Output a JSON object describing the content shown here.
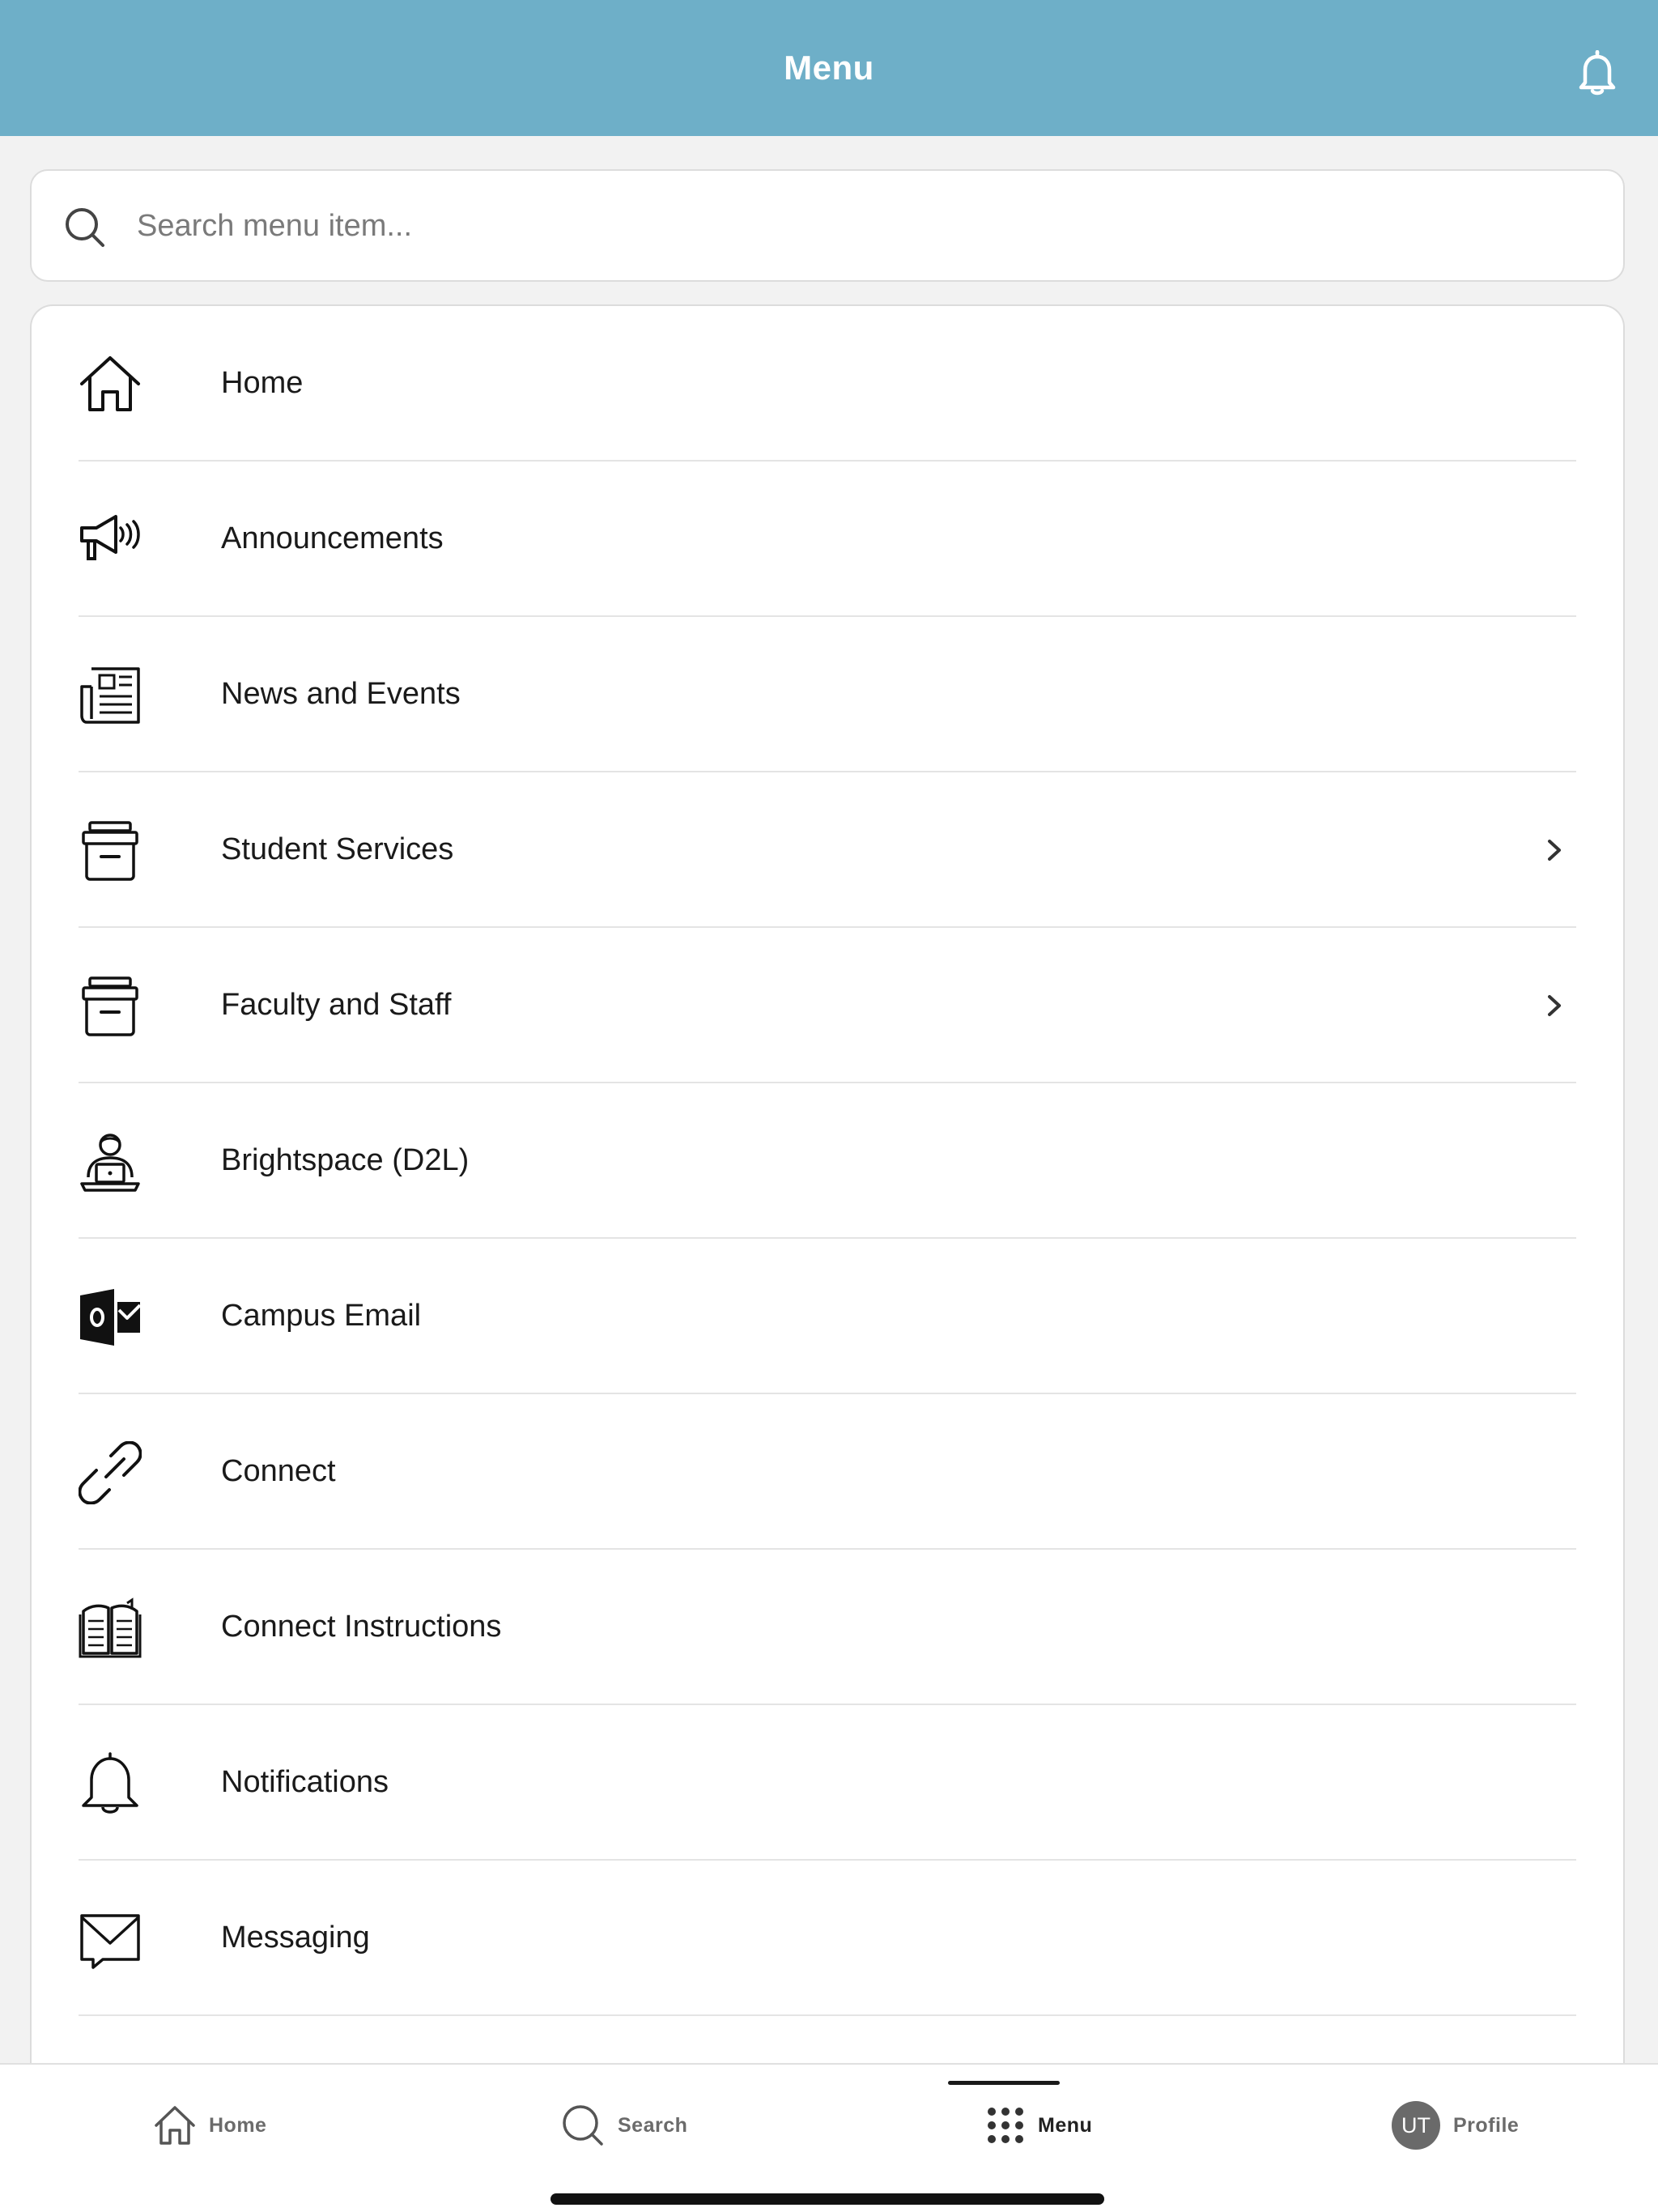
{
  "header": {
    "title": "Menu",
    "bell_icon": "bell-icon",
    "background_color": "#6eafc8"
  },
  "search": {
    "placeholder": "Search menu item...",
    "value": "",
    "icon": "search-icon"
  },
  "menu": {
    "items": [
      {
        "label": "Home",
        "icon": "home-icon",
        "has_chevron": false
      },
      {
        "label": "Announcements",
        "icon": "megaphone-icon",
        "has_chevron": false
      },
      {
        "label": "News and Events",
        "icon": "newspaper-icon",
        "has_chevron": false
      },
      {
        "label": "Student Services",
        "icon": "archive-box-icon",
        "has_chevron": true
      },
      {
        "label": "Faculty and Staff",
        "icon": "archive-box-icon",
        "has_chevron": true
      },
      {
        "label": "Brightspace (D2L)",
        "icon": "student-laptop-icon",
        "has_chevron": false
      },
      {
        "label": "Campus Email",
        "icon": "outlook-icon",
        "has_chevron": false
      },
      {
        "label": "Connect",
        "icon": "link-icon",
        "has_chevron": false
      },
      {
        "label": "Connect Instructions",
        "icon": "open-book-icon",
        "has_chevron": false
      },
      {
        "label": "Notifications",
        "icon": "bell-icon",
        "has_chevron": false
      },
      {
        "label": "Messaging",
        "icon": "envelope-icon",
        "has_chevron": false
      }
    ]
  },
  "tabbar": {
    "tabs": [
      {
        "label": "Home",
        "icon": "home-icon",
        "active": false
      },
      {
        "label": "Search",
        "icon": "search-icon",
        "active": false
      },
      {
        "label": "Menu",
        "icon": "grid-dots-icon",
        "active": true
      },
      {
        "label": "Profile",
        "icon": "avatar",
        "active": false,
        "avatar_initials": "UT"
      }
    ]
  }
}
